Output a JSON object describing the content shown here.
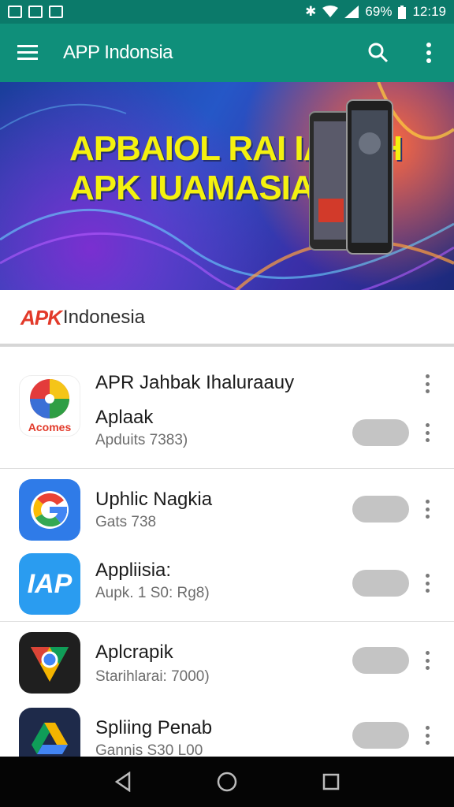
{
  "status_bar": {
    "battery": "69%",
    "time": "12:19"
  },
  "app_bar": {
    "title": "APP Indonsia"
  },
  "banner": {
    "line1": "APBAIOL RAI IAGAH",
    "line2": "APK IUAMASIA"
  },
  "brand": {
    "logo": "APK",
    "name": "Indonesia"
  },
  "featured": {
    "title": "APR Jahbak Ihaluraauy",
    "name": "Aplaak",
    "sub": "Apduits 7383)",
    "icon_label": "Acomes"
  },
  "apps": [
    {
      "name": "Uphlic Nagkia",
      "sub": "Gats 738",
      "icon": "google-icon"
    },
    {
      "name": "Appliisia:",
      "sub": "Aupk. 1 S0: Rg8)",
      "icon": "iap-icon",
      "icon_label": "IAP"
    },
    {
      "name": "Aplcrapik",
      "sub": "Starihlarai: 7000)",
      "icon": "chrome-like-icon"
    },
    {
      "name": "Spliing Penab",
      "sub": "Gannis S30 L00",
      "icon": "drive-like-icon"
    }
  ],
  "colors": {
    "appbar": "#0f8f7a",
    "status": "#0b7a6a",
    "banner_text": "#f4f10f",
    "accent_red": "#e23a2a"
  }
}
